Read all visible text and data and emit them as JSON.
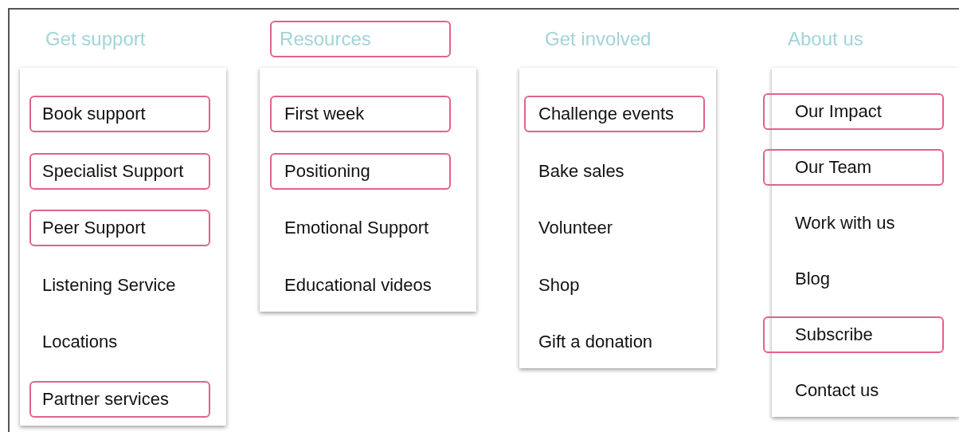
{
  "columns": [
    {
      "heading": {
        "text": "Get support",
        "highlighted": false
      },
      "items": [
        {
          "label": "Book support",
          "highlighted": true
        },
        {
          "label": "Specialist Support",
          "highlighted": true
        },
        {
          "label": "Peer Support",
          "highlighted": true
        },
        {
          "label": "Listening Service",
          "highlighted": false
        },
        {
          "label": "Locations",
          "highlighted": false
        },
        {
          "label": "Partner services",
          "highlighted": true
        }
      ]
    },
    {
      "heading": {
        "text": "Resources",
        "highlighted": true
      },
      "items": [
        {
          "label": "First week",
          "highlighted": true
        },
        {
          "label": "Positioning",
          "highlighted": true
        },
        {
          "label": "Emotional Support",
          "highlighted": false
        },
        {
          "label": "Educational videos",
          "highlighted": false
        }
      ]
    },
    {
      "heading": {
        "text": "Get involved",
        "highlighted": false
      },
      "items": [
        {
          "label": "Challenge events",
          "highlighted": true
        },
        {
          "label": "Bake sales",
          "highlighted": false
        },
        {
          "label": "Volunteer",
          "highlighted": false
        },
        {
          "label": "Shop",
          "highlighted": false
        },
        {
          "label": "Gift a donation",
          "highlighted": false
        }
      ]
    },
    {
      "heading": {
        "text": "About us",
        "highlighted": false
      },
      "items": [
        {
          "label": "Our Impact",
          "highlighted": true
        },
        {
          "label": "Our Team",
          "highlighted": true
        },
        {
          "label": "Work with us",
          "highlighted": false
        },
        {
          "label": "Blog",
          "highlighted": false
        },
        {
          "label": "Subscribe",
          "highlighted": true
        },
        {
          "label": "Contact us",
          "highlighted": false
        }
      ]
    }
  ]
}
